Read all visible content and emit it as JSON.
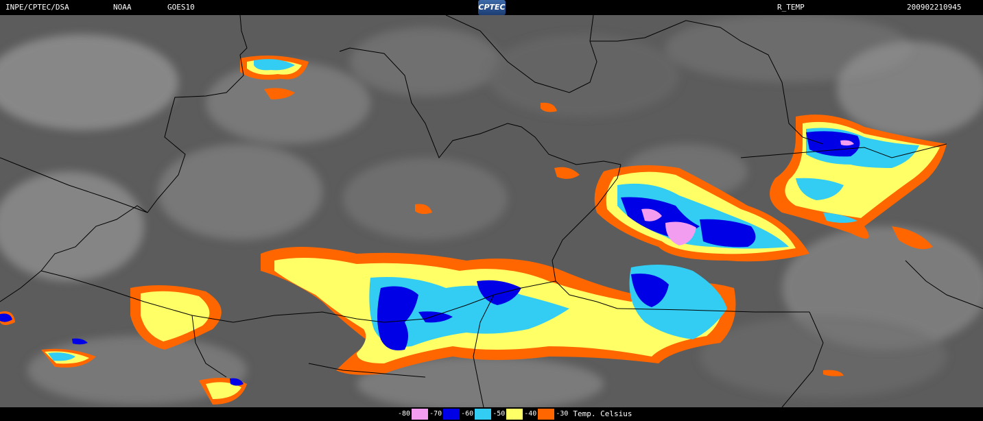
{
  "header": {
    "source": "INPE/CPTEC/DSA",
    "agency": "NOAA",
    "satellite": "GOES10",
    "logo_text": "CPTEC",
    "product": "R_TEMP",
    "datetime": "200902210945"
  },
  "legend": {
    "items": [
      {
        "label": "-80",
        "color": "#f39df0"
      },
      {
        "label": "-70",
        "color": "#0000e6"
      },
      {
        "label": "-60",
        "color": "#33ccf2"
      },
      {
        "label": "-50",
        "color": "#ffff66"
      },
      {
        "label": "-40",
        "color": "#ff6600"
      },
      {
        "label": "-30",
        "color": ""
      }
    ],
    "unit_label": "Temp. Celsius"
  },
  "colors": {
    "background": "#000000",
    "cloud_gray": "#8a8a8a",
    "land_gray": "#555555",
    "border_line": "#000000"
  }
}
